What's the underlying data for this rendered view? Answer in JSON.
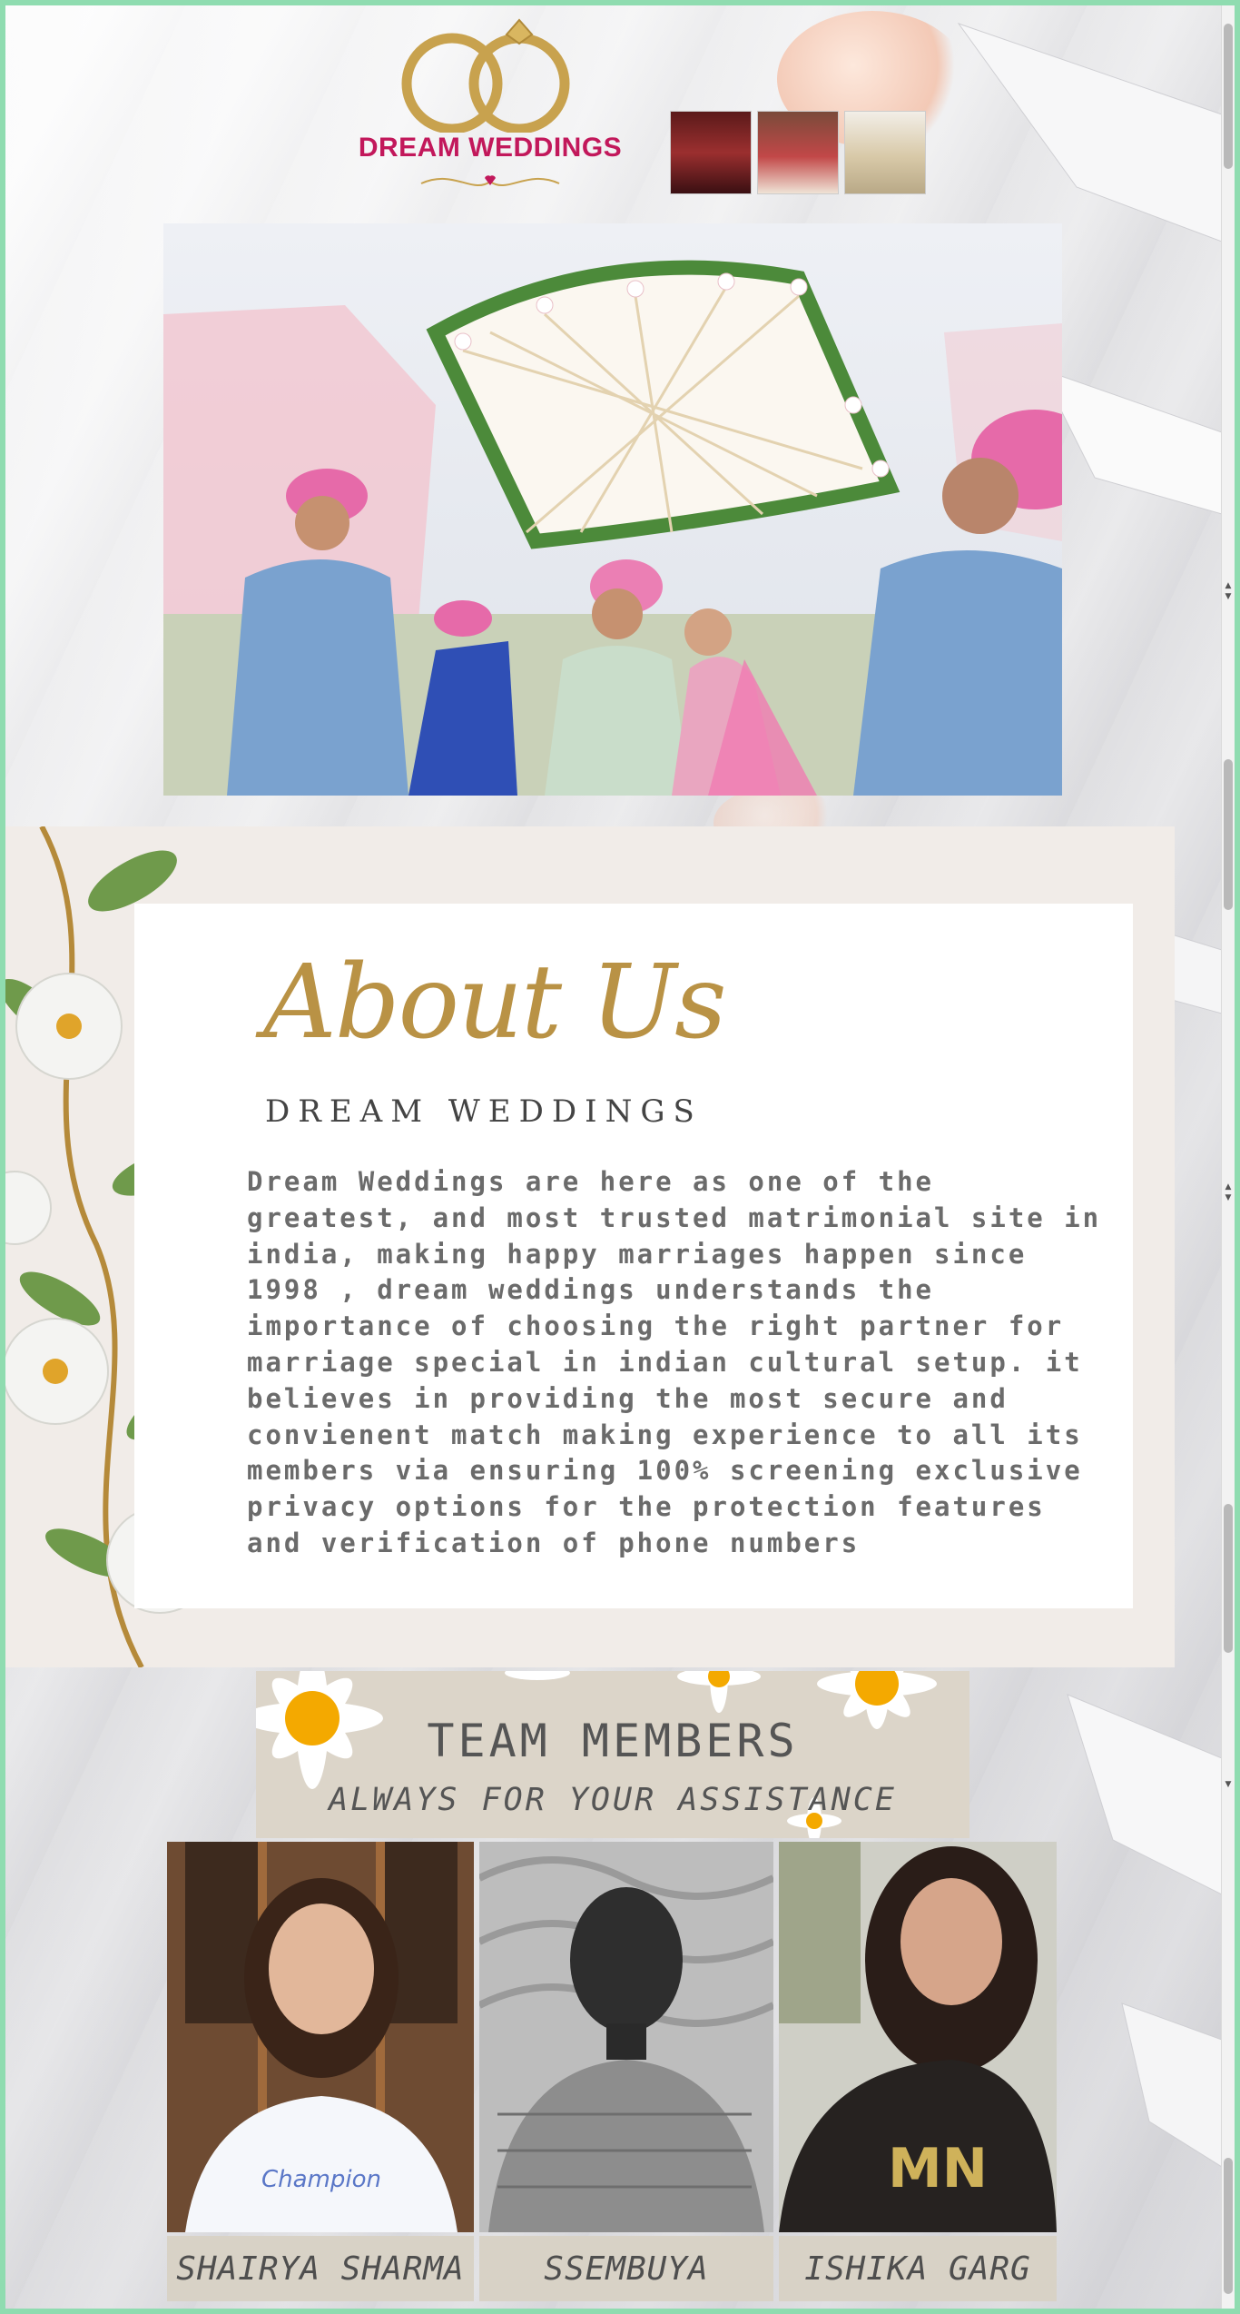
{
  "brand": {
    "name": "DREAM WEDDINGS",
    "accent": "#c2185b",
    "gold": "#c8a24e"
  },
  "about": {
    "title": "About Us",
    "subtitle": "DREAM WEDDINGS",
    "body": "Dream Weddings are here as one of the greatest, and most trusted matrimonial site in india, making happy marriages happen since 1998 , dream weddings understands the importance of choosing the right partner for marriage special in indian cultural setup. it believes in providing the most secure and convienent match making experience to all its members via ensuring 100% screening exclusive privacy options for the protection features and verification of phone numbers"
  },
  "team": {
    "title": "TEAM MEMBERS",
    "tagline": "ALWAYS FOR YOUR ASSISTANCE",
    "members": [
      {
        "name": "SHAIRYA SHARMA"
      },
      {
        "name": "SSEMBUYA"
      },
      {
        "name": "ISHIKA GARG"
      }
    ]
  },
  "colors": {
    "frame": "#8fdcb0",
    "about_panel": "#f1ece8",
    "team_banner": "#dcd5c9",
    "daisy_center": "#f4a900"
  }
}
